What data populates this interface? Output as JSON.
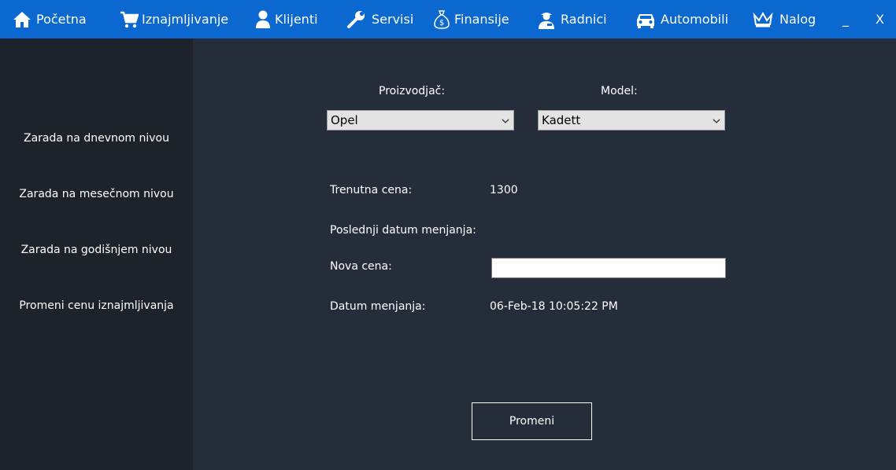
{
  "nav": {
    "home": "Početna",
    "rentals": "Iznajmljivanje",
    "clients": "Klijenti",
    "services": "Servisi",
    "finances": "Finansije",
    "workers": "Radnici",
    "cars": "Automobili",
    "account": "Nalog",
    "minimize": "_",
    "close": "X"
  },
  "sidebar": {
    "items": [
      {
        "label": "Zarada na dnevnom nivou"
      },
      {
        "label": "Zarada na mesečnom nivou"
      },
      {
        "label": "Zarada na godišnjem nivou"
      },
      {
        "label": "Promeni cenu iznajmljivanja"
      }
    ]
  },
  "form": {
    "manufacturer_label": "Proizvodjač:",
    "manufacturer_value": "Opel",
    "model_label": "Model:",
    "model_value": "Kadett",
    "current_price_label": "Trenutna cena:",
    "current_price_value": "1300",
    "last_change_label": "Poslednji datum menjanja:",
    "last_change_value": "",
    "new_price_label": "Nova cena:",
    "new_price_value": "",
    "change_date_label": "Datum menjanja:",
    "change_date_value": "06-Feb-18  10:05:22 PM",
    "submit_label": "Promeni"
  },
  "colors": {
    "topbar": "#0b68d0",
    "sidebar": "#1e222a",
    "main": "#252d3a"
  }
}
